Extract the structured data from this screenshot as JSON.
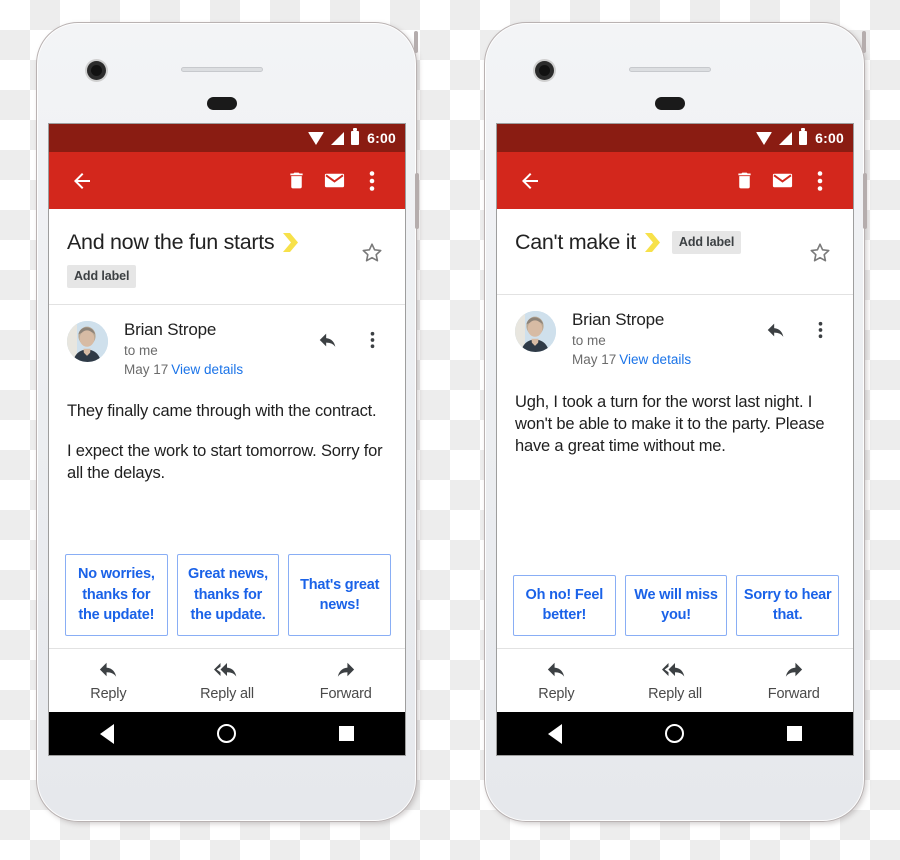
{
  "background": {
    "type": "transparency-checkerboard"
  },
  "colors": {
    "status_bar": "#8a1c12",
    "app_bar": "#d3271c",
    "link": "#1a73e8",
    "chip_text": "#1a62e8",
    "chip_border": "#89aef5",
    "label_yellow": "#f7e14a"
  },
  "phones": [
    {
      "id": "phone-left",
      "status_bar": {
        "time": "6:00",
        "icons": [
          "wifi-icon",
          "signal-icon",
          "battery-icon"
        ]
      },
      "app_bar": {
        "back_icon": "arrow-back-icon",
        "actions": [
          "delete-icon",
          "mark-unread-icon",
          "more-options-icon"
        ]
      },
      "subject": {
        "text": "And now the fun starts",
        "label_marker_icon": "label-chevron-icon",
        "add_label": "Add label",
        "add_label_placement": "below",
        "star_icon": "star-outline-icon"
      },
      "sender": {
        "avatar": "avatar",
        "name": "Brian Strope",
        "to": "to me",
        "date": "May 17",
        "details_link": "View details",
        "reply_icon": "reply-icon",
        "more_icon": "more-options-icon"
      },
      "body_paragraphs": [
        "They finally came through with the contract.",
        "I expect the work to start tomorrow. Sorry for all the delays."
      ],
      "smart_replies": [
        "No worries, thanks for the update!",
        "Great news, thanks for the update.",
        "That's great news!"
      ],
      "reply_bar": [
        {
          "label": "Reply",
          "icon": "reply-icon"
        },
        {
          "label": "Reply all",
          "icon": "reply-all-icon"
        },
        {
          "label": "Forward",
          "icon": "forward-icon"
        }
      ],
      "nav_bar": [
        "back-nav-icon",
        "home-nav-icon",
        "recents-nav-icon"
      ]
    },
    {
      "id": "phone-right",
      "status_bar": {
        "time": "6:00",
        "icons": [
          "wifi-icon",
          "signal-icon",
          "battery-icon"
        ]
      },
      "app_bar": {
        "back_icon": "arrow-back-icon",
        "actions": [
          "delete-icon",
          "mark-unread-icon",
          "more-options-icon"
        ]
      },
      "subject": {
        "text": "Can't make it",
        "label_marker_icon": "label-chevron-icon",
        "add_label": "Add label",
        "add_label_placement": "inline",
        "star_icon": "star-outline-icon"
      },
      "sender": {
        "avatar": "avatar",
        "name": "Brian Strope",
        "to": "to me",
        "date": "May 17",
        "details_link": "View details",
        "reply_icon": "reply-icon",
        "more_icon": "more-options-icon"
      },
      "body_paragraphs": [
        "Ugh, I took a turn for the worst last night. I won't be able to make it to the party. Please have a great time without me."
      ],
      "smart_replies": [
        "Oh no! Feel better!",
        "We will miss you!",
        "Sorry to hear that."
      ],
      "reply_bar": [
        {
          "label": "Reply",
          "icon": "reply-icon"
        },
        {
          "label": "Reply all",
          "icon": "reply-all-icon"
        },
        {
          "label": "Forward",
          "icon": "forward-icon"
        }
      ],
      "nav_bar": [
        "back-nav-icon",
        "home-nav-icon",
        "recents-nav-icon"
      ]
    }
  ]
}
